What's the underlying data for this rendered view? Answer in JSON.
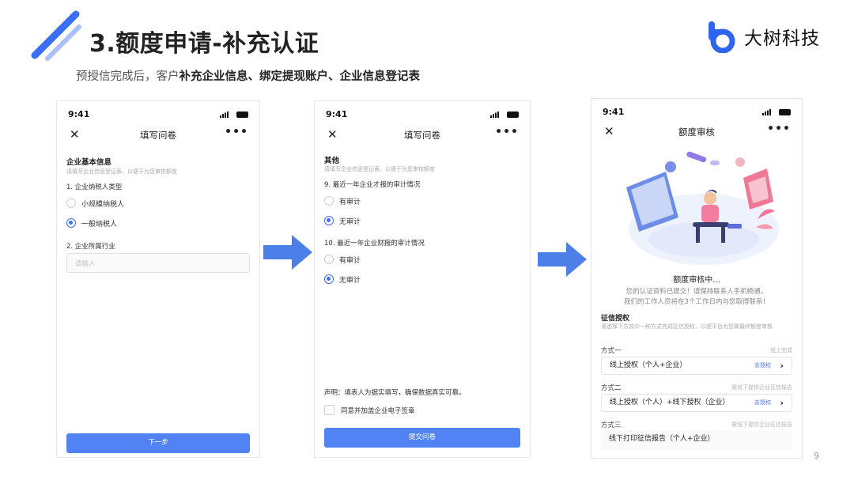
{
  "slide": {
    "title": "3.额度申请-补充认证",
    "subtitle_prefix": "预授信完成后，客户",
    "subtitle_bold": "补充企业信息、绑定提现账户、企业信息登记表",
    "page_number": "9",
    "accent_color": "#3b6ff5",
    "brand": {
      "name": "大树科技",
      "logo_icon": "tree-b-logo-icon"
    }
  },
  "status_bar": {
    "time": "9:41"
  },
  "screen1": {
    "nav_title": "填写问卷",
    "section_title": "企业基本信息",
    "section_sub": "请填写企业信息登记表，以便于为您审核额度",
    "q1": "1. 企业纳税人类型",
    "options": [
      "小规模纳税人",
      "一般纳税人"
    ],
    "selected_index": 1,
    "q2": "2. 企业所属行业",
    "input_placeholder": "请输入",
    "next_button": "下一步"
  },
  "screen2": {
    "nav_title": "填写问卷",
    "section_title": "其他",
    "section_sub": "请填写企业信息登记表，以便于为您审核额度",
    "q9": "9. 最近一年企业才报的审计情况",
    "q9_options": [
      "有审计",
      "无审计"
    ],
    "q9_selected": 1,
    "q10": "10. 最近一年企业财报的审计情况",
    "q10_options": [
      "有审计",
      "无审计"
    ],
    "q10_selected": 1,
    "statement": "声明：填表人为据实填写，确保数据真实可靠。",
    "agree_label": "同意并加盖企业电子签章",
    "submit_button": "提交问卷"
  },
  "screen3": {
    "nav_title": "额度审核",
    "status_title": "额度审核中...",
    "status_line1": "您的认证资料已提交！请保持联系人手机畅通，",
    "status_line2": "我们的工作人员将在3个工作日内与您取得联系！",
    "credit_title": "征信授权",
    "credit_sub": "请选择下方其中一种方式完成征信授权，以便平台为您做最终额度审核",
    "methods": [
      {
        "label": "方式一",
        "hint": "线上完成",
        "card": "线上授权（个人+企业）",
        "link": "去授权"
      },
      {
        "label": "方式二",
        "hint": "需线下提供企业征信报告",
        "card": "线上授权（个人）+线下授权（企业）",
        "link": "去授权"
      },
      {
        "label": "方式三",
        "hint": "需线下提供企业征信报告",
        "card": "线下打印征信报告（个人+企业）",
        "link": ""
      }
    ]
  }
}
